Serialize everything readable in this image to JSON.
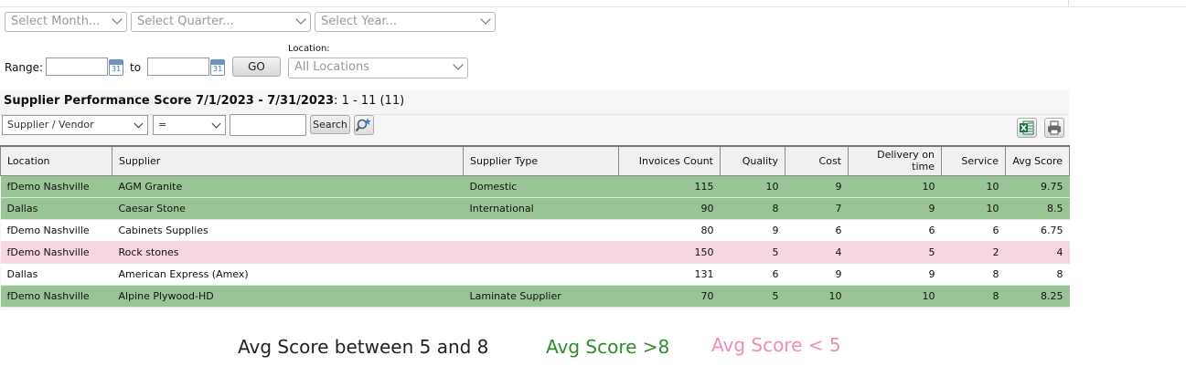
{
  "filters": {
    "month_placeholder": "Select Month...",
    "quarter_placeholder": "Select Quarter...",
    "year_placeholder": "Select Year...",
    "range_label": "Range:",
    "to_label": "to",
    "calendar_day": "31",
    "go_label": "GO",
    "location_label": "Location:",
    "location_value": "All Locations"
  },
  "report": {
    "title": "Supplier Performance Score 7/1/2023 - 7/31/2023",
    "count": ": 1 - 11 (11)",
    "field_filter": "Supplier / Vendor",
    "operator": "=",
    "search_label": "Search"
  },
  "table": {
    "headers": [
      "Location",
      "Supplier",
      "Supplier Type",
      "Invoices Count",
      "Quality",
      "Cost",
      "Delivery on time",
      "Service",
      "Avg Score"
    ],
    "rows": [
      [
        "fDemo Nashville",
        "AGM Granite",
        "Domestic",
        "115",
        "10",
        "9",
        "10",
        "10",
        "9.75"
      ],
      [
        "Dallas",
        "Caesar Stone",
        "International",
        "90",
        "8",
        "7",
        "9",
        "10",
        "8.5"
      ],
      [
        "fDemo Nashville",
        "Cabinets Supplies",
        "",
        "80",
        "9",
        "6",
        "6",
        "6",
        "6.75"
      ],
      [
        "fDemo Nashville",
        "Rock stones",
        "",
        "150",
        "5",
        "4",
        "5",
        "2",
        "4"
      ],
      [
        "Dallas",
        "American Express (Amex)",
        "",
        "131",
        "6",
        "9",
        "9",
        "8",
        "8"
      ],
      [
        "fDemo Nashville",
        "Alpine Plywood-HD",
        "Laminate Supplier",
        "70",
        "5",
        "10",
        "10",
        "8",
        "8.25"
      ]
    ],
    "row_status": [
      "green",
      "green",
      "white",
      "pink",
      "white",
      "green"
    ]
  },
  "legend": {
    "mid": "Avg Score between 5 and 8",
    "high": "Avg Score >8",
    "low": "Avg Score < 5",
    "mid_color": "#222222",
    "high_color": "#2e8b2e",
    "low_color": "#f08cb8"
  },
  "colors": {
    "row_green": "#99c596",
    "row_pink": "#f6d6df"
  }
}
